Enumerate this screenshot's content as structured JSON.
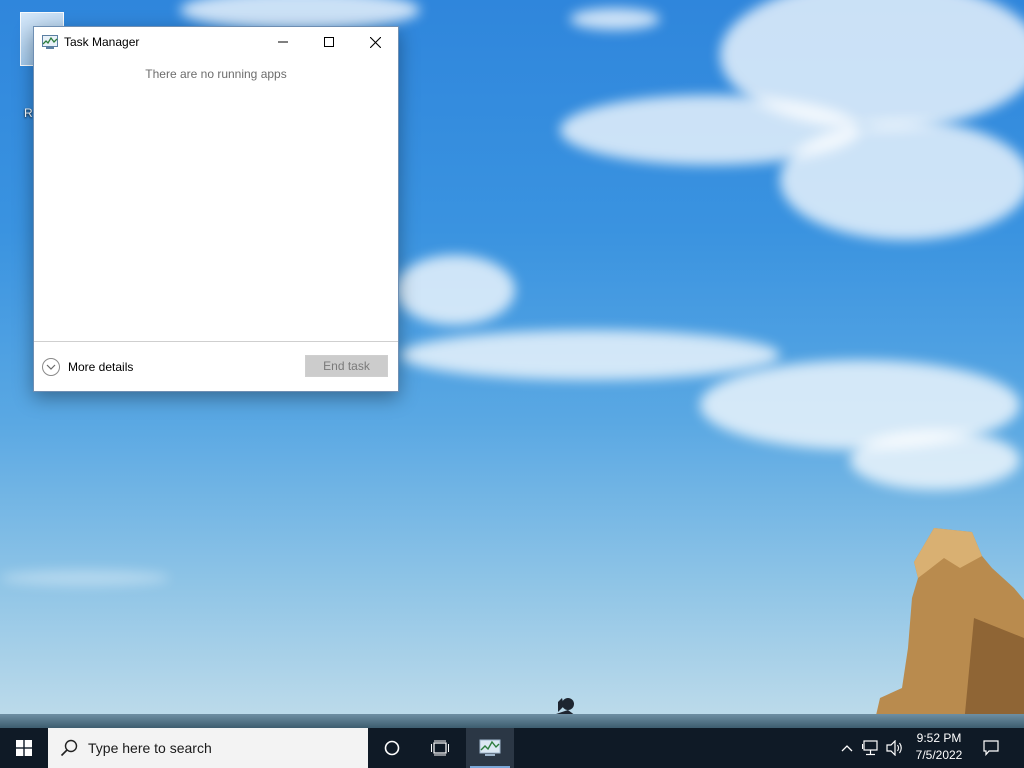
{
  "desktop": {
    "recycle_bin_label": "R"
  },
  "window": {
    "title": "Task Manager",
    "empty_message": "There are no running apps",
    "more_details_label": "More details",
    "end_task_label": "End task"
  },
  "taskbar": {
    "search_placeholder": "Type here to search",
    "clock_time": "9:52 PM",
    "clock_date": "7/5/2022"
  },
  "colors": {
    "taskbar_bg": "#0f1a26",
    "search_bg": "#f3f3f3",
    "window_border": "#6f8fb3"
  }
}
